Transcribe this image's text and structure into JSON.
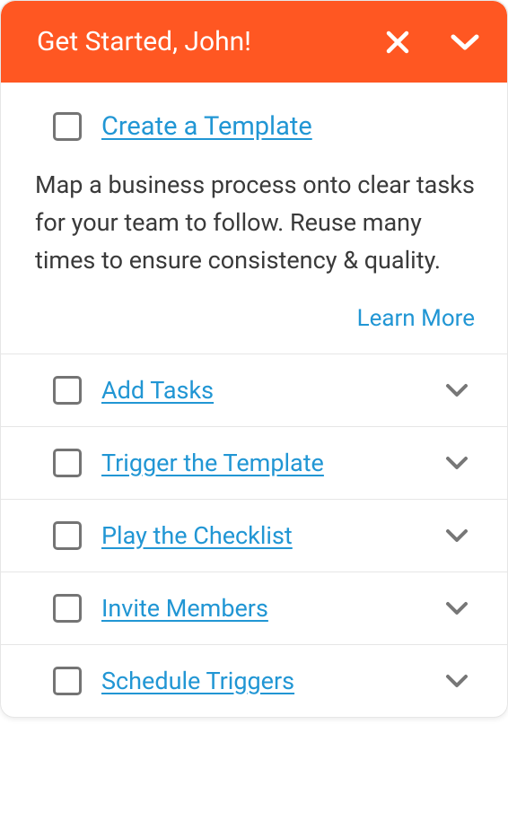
{
  "header": {
    "title": "Get Started, John!"
  },
  "expanded": {
    "title": "Create a Template",
    "description": "Map a business process onto clear tasks for your team to follow. Reuse many times to ensure consistency & quality.",
    "learn_more": "Learn More"
  },
  "items": [
    {
      "label": "Add Tasks"
    },
    {
      "label": "Trigger the Template"
    },
    {
      "label": "Play the Checklist"
    },
    {
      "label": "Invite Members"
    },
    {
      "label": "Schedule Triggers"
    }
  ]
}
